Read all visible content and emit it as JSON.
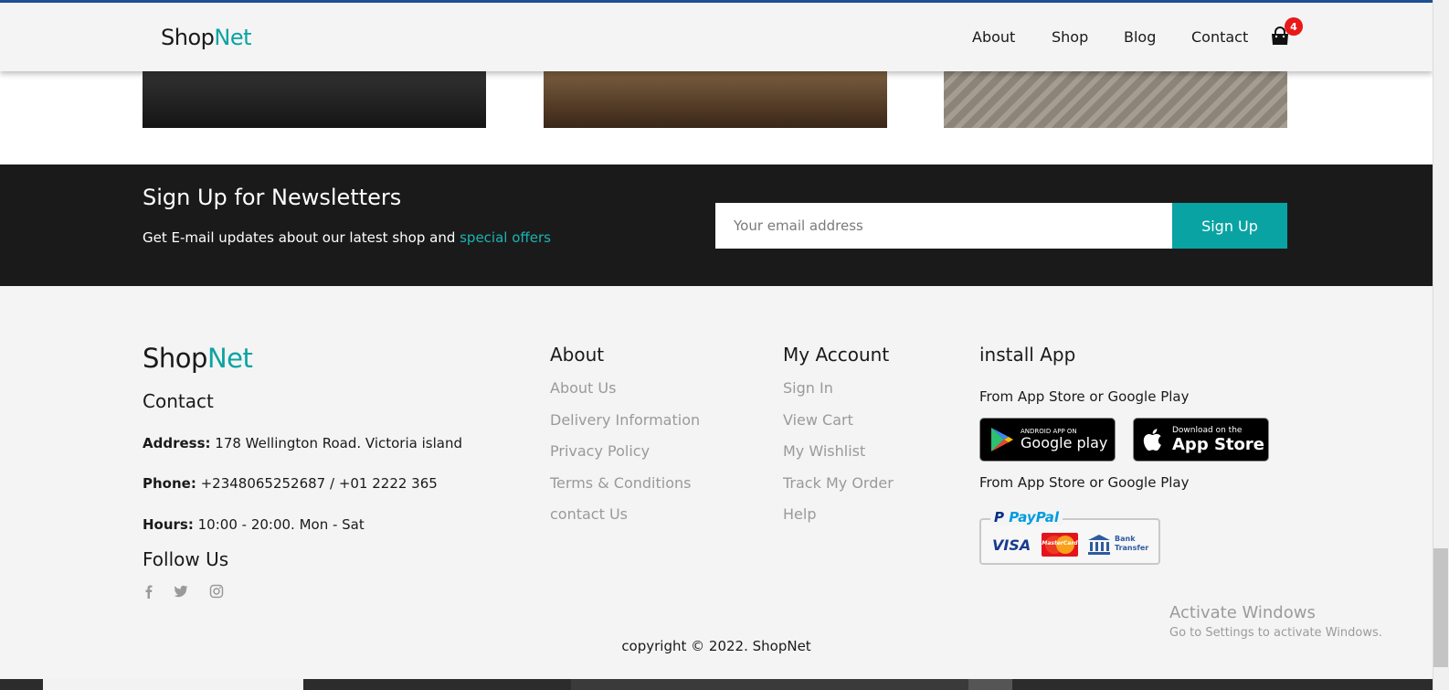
{
  "header": {
    "logo_main": "Shop",
    "logo_accent": "Net",
    "nav": [
      "About",
      "Shop",
      "Blog",
      "Contact"
    ],
    "cart_count": "4",
    "cart_icon": "shopping-bag-icon"
  },
  "newsletter": {
    "title": "Sign Up for Newsletters",
    "subtitle_prefix": "Get E-mail updates about our latest shop and ",
    "subtitle_highlight": "special offers",
    "email_placeholder": "Your email address",
    "button_label": "Sign Up"
  },
  "footer": {
    "logo_main": "Shop",
    "logo_accent": "Net",
    "contact_heading": "Contact",
    "address_label": "Address:",
    "address_value": " 178 Wellington Road. Victoria island",
    "phone_label": "Phone:",
    "phone_value": " +2348065252687 / +01 2222 365",
    "hours_label": "Hours:",
    "hours_value": " 10:00 - 20:00. Mon - Sat",
    "follow_heading": "Follow Us",
    "social_icons": [
      "facebook-icon",
      "twitter-icon",
      "instagram-icon"
    ],
    "about_heading": "About",
    "about_links": [
      "About Us",
      "Delivery Information",
      "Privacy Policy",
      "Terms & Conditions",
      "contact Us"
    ],
    "account_heading": "My Account",
    "account_links": [
      "Sign In",
      "View Cart",
      "My Wishlist",
      "Track My Order",
      "Help"
    ],
    "app_heading": "install App",
    "app_text_1": "From App Store or Google Play",
    "app_text_2": "From App Store or Google Play",
    "google_play_small": "ANDROID APP ON",
    "google_play_big": "Google play",
    "app_store_small": "Download on the",
    "app_store_big": "App Store",
    "payment_paypal": "PayPal",
    "payment_visa": "VISA",
    "payment_mastercard": "MasterCard",
    "payment_bank": "Bank Transfer",
    "copyright": "copyright © 2022. ShopNet"
  },
  "os_watermark": {
    "title": "Activate Windows",
    "subtitle": "Go to Settings to activate Windows."
  },
  "colors": {
    "accent": "#0aa3a3",
    "header_bg": "#f4f4f4",
    "newsletter_bg": "#1b1a1b",
    "badge": "#e81919"
  }
}
